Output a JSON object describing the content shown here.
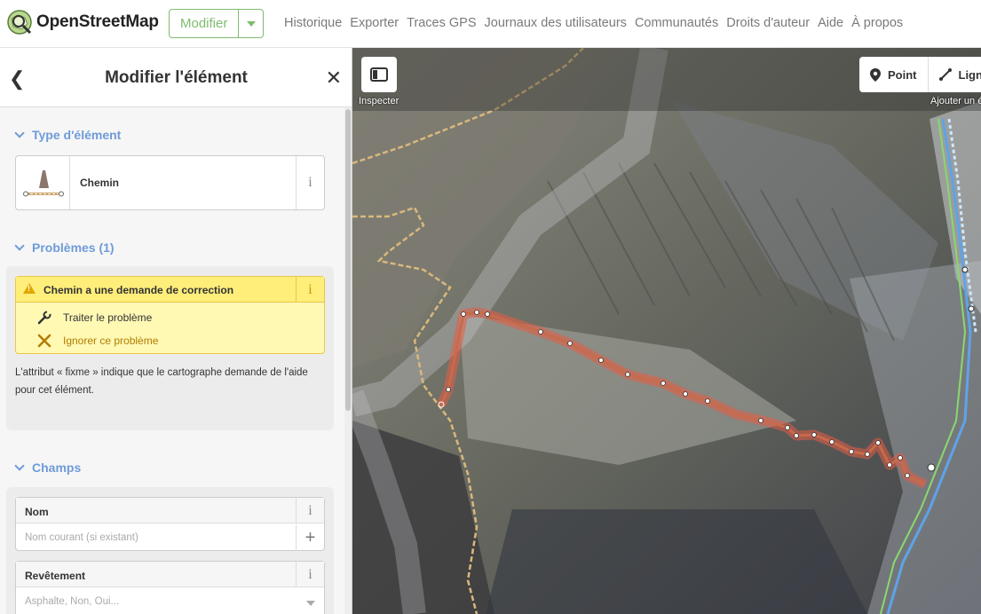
{
  "brand": {
    "name": "OpenStreetMap"
  },
  "header": {
    "edit_label": "Modifier",
    "nav": [
      "Historique",
      "Exporter",
      "Traces GPS",
      "Journaux des utilisateurs",
      "Communautés",
      "Droits d'auteur",
      "Aide",
      "À propos"
    ]
  },
  "sidebar": {
    "title": "Modifier l'élément",
    "type_section": "Type d'élément",
    "preset_name": "Chemin",
    "issues_section": "Problèmes (1)",
    "issue": {
      "title": "Chemin a une demande de correction",
      "fix1": "Traiter le problème",
      "fix2": "Ignorer ce problème",
      "description": "L'attribut « fixme » indique que le cartographe demande de l'aide pour cet élément."
    },
    "fields_section": "Champs",
    "fields": [
      {
        "label": "Nom",
        "placeholder": "Nom courant (si existant)"
      },
      {
        "label": "Revêtement",
        "placeholder": "Asphalte, Non, Oui..."
      }
    ]
  },
  "map": {
    "inspect_label": "Inspecter",
    "modes": [
      "Point",
      "Ligne"
    ],
    "add_label": "Ajouter un é"
  },
  "colors": {
    "accent": "#7ebc6f",
    "section": "#6f9bd9",
    "warning_bg": "#fff9b4",
    "selected_way": "#e0604a"
  }
}
